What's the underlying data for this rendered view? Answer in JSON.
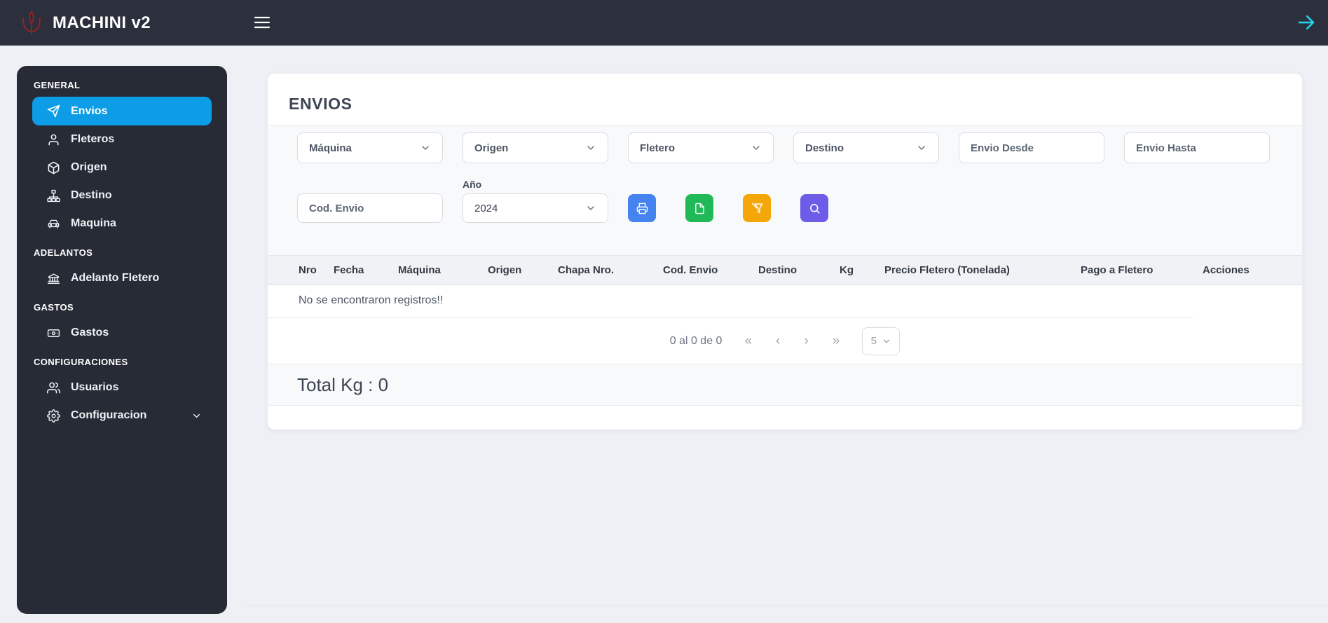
{
  "navbar": {
    "brand": "MACHINI v2",
    "menu_icon": "hamburger-icon",
    "logout_icon": "arrow-right-icon"
  },
  "sidebar": {
    "sections": [
      {
        "label": "GENERAL",
        "items": [
          {
            "label": "Envios",
            "icon": "paper-plane-icon",
            "active": true
          },
          {
            "label": "Fleteros",
            "icon": "person-icon"
          },
          {
            "label": "Origen",
            "icon": "cube-icon"
          },
          {
            "label": "Destino",
            "icon": "sitemap-icon"
          },
          {
            "label": "Maquina",
            "icon": "car-icon"
          }
        ]
      },
      {
        "label": "ADELANTOS",
        "items": [
          {
            "label": "Adelanto Fletero",
            "icon": "bank-icon"
          }
        ]
      },
      {
        "label": "GASTOS",
        "items": [
          {
            "label": "Gastos",
            "icon": "money-icon"
          }
        ]
      },
      {
        "label": "CONFIGURACIONES",
        "items": [
          {
            "label": "Usuarios",
            "icon": "users-icon"
          },
          {
            "label": "Configuracion",
            "icon": "gear-icon",
            "expandable": true
          }
        ]
      }
    ]
  },
  "main": {
    "title": "ENVIOS",
    "filters": {
      "maquina": "Máquina",
      "origen": "Origen",
      "fletero": "Fletero",
      "destino": "Destino",
      "envio_desde": "Envio Desde",
      "envio_hasta": "Envio Hasta",
      "cod_envio": "Cod. Envio",
      "anio_label": "Año",
      "anio_value": "2024"
    },
    "action_buttons": [
      {
        "name": "print",
        "icon": "printer-icon",
        "color": "#4483f0"
      },
      {
        "name": "export",
        "icon": "file-icon",
        "color": "#1fba57"
      },
      {
        "name": "clear-filters",
        "icon": "filter-off-icon",
        "color": "#f5a608"
      },
      {
        "name": "search",
        "icon": "search-icon",
        "color": "#6c5ce7"
      }
    ],
    "table": {
      "columns": [
        "Nro",
        "Fecha",
        "Máquina",
        "Origen",
        "Chapa Nro.",
        "Cod. Envio",
        "Destino",
        "Kg",
        "Precio Fletero (Tonelada)",
        "Pago a Fletero",
        "Acciones"
      ],
      "empty_message": "No se encontraron registros!!"
    },
    "pagination": {
      "summary": "0 al 0 de 0",
      "first": "«",
      "prev": "‹",
      "next": "›",
      "last": "»",
      "page_size": "5"
    },
    "total": "Total Kg : 0"
  },
  "colors": {
    "active_item": "#0d9de6",
    "logout_arrow": "#22d3ee",
    "logo": "#a01d22",
    "print_button": "#4483f0",
    "export_button": "#1fba57",
    "clear_button": "#f5a608",
    "search_button": "#6c5ce7"
  }
}
